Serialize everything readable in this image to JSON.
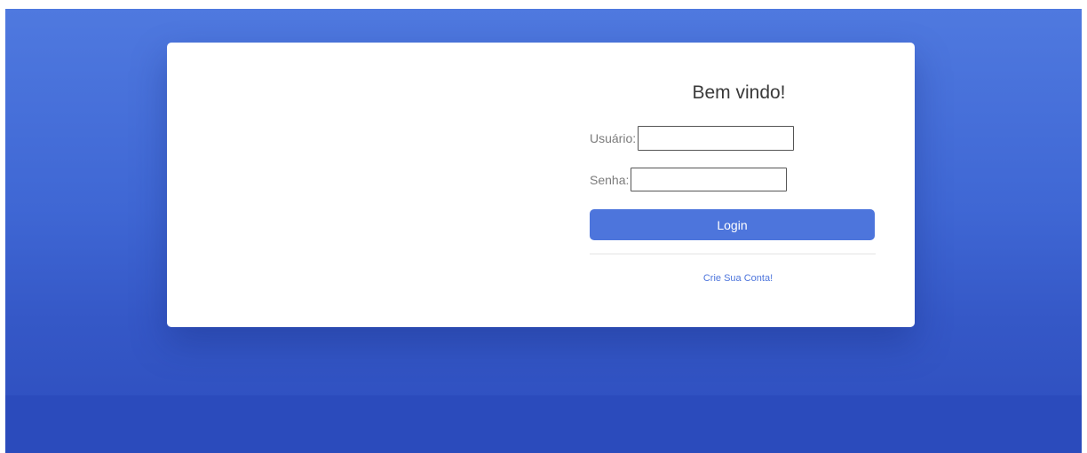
{
  "login": {
    "welcome": "Bem vindo!",
    "username_label": "Usuário:",
    "username_value": "",
    "password_label": "Senha:",
    "password_value": "",
    "login_button": "Login",
    "signup_link": "Crie Sua Conta!"
  },
  "colors": {
    "background_top": "#4f79df",
    "background_bottom": "#2d4dbd",
    "accent": "#4d75dc",
    "card": "#ffffff"
  }
}
